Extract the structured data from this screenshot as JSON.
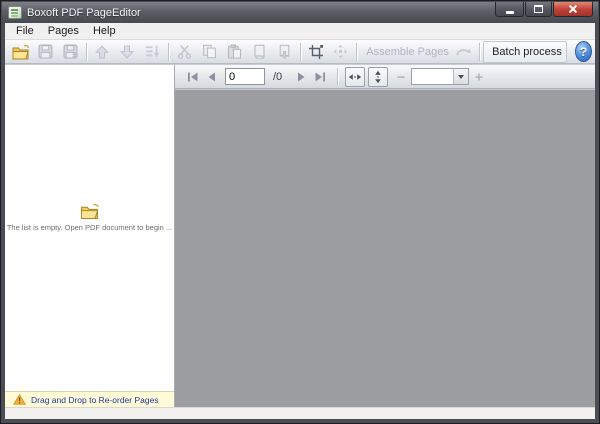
{
  "window": {
    "title": "Boxoft PDF PageEditor"
  },
  "menu": {
    "items": [
      {
        "label": "File"
      },
      {
        "label": "Pages"
      },
      {
        "label": "Help"
      }
    ]
  },
  "toolbar": {
    "assemble_pages_label": "Assemble Pages",
    "batch_process_label": "Batch process",
    "help_glyph": "?",
    "buttons": [
      {
        "name": "open-pdf",
        "icon": "open-folder-icon",
        "enabled": true
      },
      {
        "name": "save",
        "icon": "save-icon",
        "enabled": false
      },
      {
        "name": "save-as",
        "icon": "save-as-icon",
        "enabled": false
      },
      {
        "name": "move-up",
        "icon": "arrow-up-icon",
        "enabled": false
      },
      {
        "name": "move-down",
        "icon": "arrow-down-icon",
        "enabled": false
      },
      {
        "name": "sort-pages",
        "icon": "sort-icon",
        "enabled": false
      },
      {
        "name": "cut",
        "icon": "scissors-icon",
        "enabled": false
      },
      {
        "name": "copy",
        "icon": "copy-icon",
        "enabled": false
      },
      {
        "name": "paste",
        "icon": "paste-icon",
        "enabled": false
      },
      {
        "name": "rotate-page",
        "icon": "rotate-page-icon",
        "enabled": false
      },
      {
        "name": "extract-page",
        "icon": "extract-page-icon",
        "enabled": false
      },
      {
        "name": "crop-page",
        "icon": "crop-icon",
        "enabled": true
      },
      {
        "name": "expand-page",
        "icon": "expand-icon",
        "enabled": false
      },
      {
        "name": "assemble-pages",
        "icon": "grid-icon",
        "enabled": false
      },
      {
        "name": "undo",
        "icon": "undo-icon",
        "enabled": false
      },
      {
        "name": "batch-process",
        "icon": "batch-gear-icon",
        "enabled": true
      },
      {
        "name": "help",
        "icon": "help-icon",
        "enabled": true
      }
    ]
  },
  "navbar": {
    "current_page": "0",
    "total_pages_label": "/0",
    "zoom_value": "",
    "buttons": [
      "first-page",
      "previous-page",
      "next-page",
      "last-page",
      "fit-width",
      "fit-height",
      "zoom-out",
      "zoom-in"
    ]
  },
  "left_panel": {
    "empty_message": "The list is empty. Open  PDF document to begin ...",
    "footer_message": "Drag and Drop to Re-order Pages"
  },
  "colors": {
    "canvas_gray": "#9c9da1",
    "footer_yellow": "#fffbd6",
    "footer_text_blue": "#20389e",
    "close_button_red": "#c1443b",
    "help_blue": "#3c7cc9",
    "folder_yellow": "#f2ca55",
    "titlebar_dark": "#55585e"
  }
}
